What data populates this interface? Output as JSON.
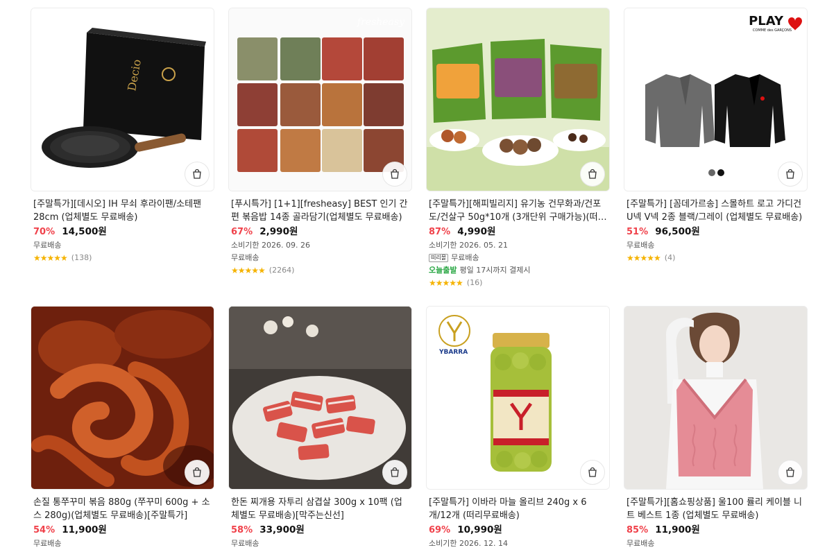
{
  "products": [
    {
      "title": "[주말특가][데시오] IH 무쇠 후라이팬/소테팬 28cm (업체별도 무료배송)",
      "discount": "70%",
      "price": "14,500원",
      "expiry": "",
      "shipping": "무료배송",
      "today_delivery": "",
      "stars": "★★★★★",
      "reviews": "(138)",
      "image": "frying-pan-product-image"
    },
    {
      "title": "[푸시특가] [1+1][fresheasy] BEST 인기 간편 볶음밥 14종 골라담기(업체별도 무료배송)",
      "discount": "67%",
      "price": "2,990원",
      "expiry": "소비기한 2026. 09. 26",
      "shipping": "무료배송",
      "today_delivery": "",
      "stars": "★★★★★",
      "reviews": "(2264)",
      "image": "fried-rice-packs-image",
      "watermark": "fresheasy"
    },
    {
      "title": "[주말특가][해피빌리지] 유기농 건무화과/건포도/건살구 50g*10개 (3개단위 구매가능)(떠리몰)",
      "discount": "87%",
      "price": "4,990원",
      "expiry": "소비기한 2026. 05. 21",
      "shipping": "무료배송",
      "ship_badge": "떠리몰",
      "today_delivery": "오늘출발",
      "today_note": "평일 17시까지 결제시",
      "stars": "★★★★★",
      "reviews": "(16)",
      "image": "dried-fruit-bags-image"
    },
    {
      "title": "[주말특가] [꼼데가르송] 스몰하트 로고 가디건 U넥 V넥 2종 블랙/그레이 (업체별도 무료배송)",
      "discount": "51%",
      "price": "96,500원",
      "expiry": "",
      "shipping": "무료배송",
      "today_delivery": "",
      "stars": "★★★★★",
      "reviews": "(4)",
      "image": "cardigans-image",
      "brand": "PLAY",
      "brand_sub": "COMME des GARÇONS"
    },
    {
      "title": "손질 통쭈꾸미 볶음 880g (쭈꾸미 600g + 소스 280g)(업체별도 무료배송)[주말특가]",
      "discount": "54%",
      "price": "11,900원",
      "shipping": "무료배송",
      "image": "spicy-octopus-image"
    },
    {
      "title": "한돈 찌개용 자투리 삼겹살 300g x 10팩 (업체별도 무료배송)[막주는신선]",
      "discount": "58%",
      "price": "33,900원",
      "shipping": "무료배송",
      "image": "pork-belly-image"
    },
    {
      "title": "[주말특가] 이바라 마늘 올리브 240g x 6개/12개 (떠리무료배송)",
      "discount": "69%",
      "price": "10,990원",
      "expiry": "소비기한 2026. 12. 14",
      "image": "olive-jar-image",
      "brand": "YBARRA"
    },
    {
      "title": "[주말특가][홈쇼핑상품] 울100 률리 케이블 니트 베스트 1종 (업체별도 무료배송)",
      "discount": "85%",
      "price": "11,900원",
      "shipping": "무료배송",
      "image": "knit-vest-model-image"
    }
  ],
  "icons": {
    "cart": "shopping-bag-icon"
  },
  "colors": {
    "discount": "#f0424b",
    "star": "#f5b300",
    "today": "#27a642"
  }
}
